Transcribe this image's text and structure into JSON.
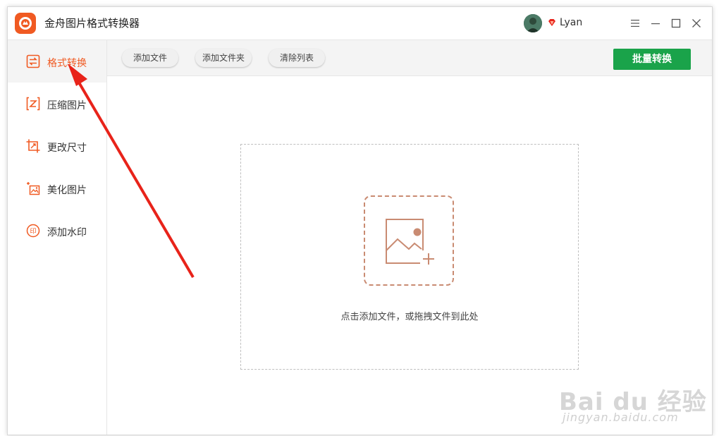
{
  "app": {
    "title": "金舟图片格式转换器",
    "username": "Lyan"
  },
  "colors": {
    "accent": "#f05a22",
    "primary_button": "#1aa34a",
    "annotation_arrow": "#e8231a"
  },
  "sidebar": {
    "items": [
      {
        "label": "格式转换",
        "icon": "format-convert-icon",
        "active": true
      },
      {
        "label": "压缩图片",
        "icon": "compress-icon",
        "active": false
      },
      {
        "label": "更改尺寸",
        "icon": "resize-icon",
        "active": false
      },
      {
        "label": "美化图片",
        "icon": "beautify-icon",
        "active": false
      },
      {
        "label": "添加水印",
        "icon": "watermark-icon",
        "active": false
      }
    ]
  },
  "toolbar": {
    "add_file": "添加文件",
    "add_folder": "添加文件夹",
    "clear_list": "清除列表",
    "batch_convert": "批量转换"
  },
  "dropzone": {
    "hint": "点击添加文件，或拖拽文件到此处"
  },
  "watermark": {
    "logo_text": "Bai du 经验",
    "url": "jingyan.baidu.com"
  }
}
